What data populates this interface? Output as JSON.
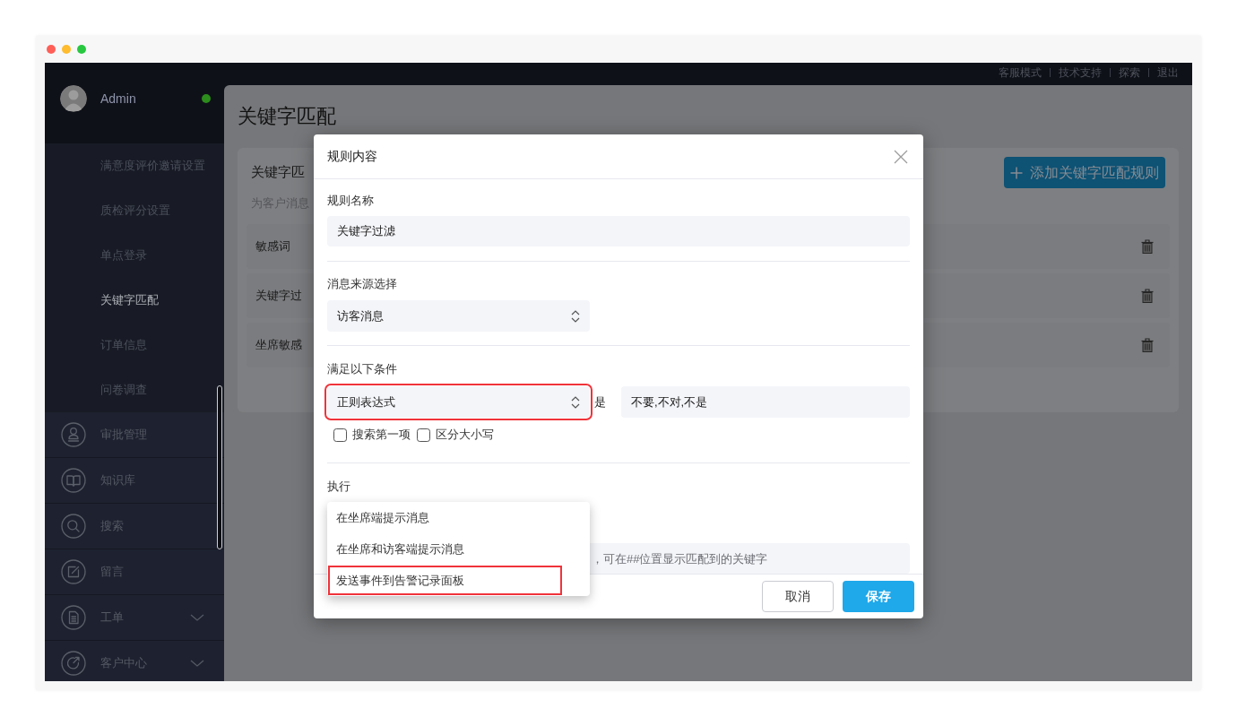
{
  "window": {
    "controls": [
      {
        "color": "#ff5f57"
      },
      {
        "color": "#febc2e"
      },
      {
        "color": "#28c840"
      }
    ]
  },
  "top_bar": {
    "links": [
      "客服模式",
      "技术支持",
      "探索",
      "退出"
    ]
  },
  "sidebar": {
    "user": {
      "name": "Admin",
      "online": true
    },
    "submenu": [
      {
        "label": "满意度评价邀请设置",
        "selected": false
      },
      {
        "label": "质检评分设置",
        "selected": false
      },
      {
        "label": "单点登录",
        "selected": false
      },
      {
        "label": "关键字匹配",
        "selected": true
      },
      {
        "label": "订单信息",
        "selected": false
      },
      {
        "label": "问卷调查",
        "selected": false
      }
    ],
    "menu": [
      {
        "label": "审批管理",
        "expandable": false
      },
      {
        "label": "知识库",
        "expandable": false
      },
      {
        "label": "搜索",
        "expandable": false
      },
      {
        "label": "留言",
        "expandable": false
      },
      {
        "label": "工单",
        "expandable": true
      },
      {
        "label": "客户中心",
        "expandable": true
      }
    ]
  },
  "page": {
    "title": "关键字匹配",
    "card": {
      "title": "关键字匹",
      "subtitle": "为客户消息",
      "add_button": "添加关键字匹配规则",
      "rules": [
        {
          "name": "敏感词"
        },
        {
          "name": "关键字过"
        },
        {
          "name": "坐席敏感"
        }
      ]
    }
  },
  "dialog": {
    "title": "规则内容",
    "rule_name": {
      "label": "规则名称",
      "value": "关键字过滤"
    },
    "source": {
      "label": "消息来源选择",
      "value": "访客消息"
    },
    "conditions": {
      "label": "满足以下条件",
      "match_type": {
        "value": "正则表达式",
        "highlighted": true
      },
      "operator": "是",
      "keywords": {
        "value": "不要,不对,不是"
      },
      "options": [
        {
          "label": "搜索第一项",
          "checked": false
        },
        {
          "label": "区分大小写",
          "checked": false
        }
      ]
    },
    "action": {
      "label": "执行",
      "menu": [
        {
          "label": "在坐席端提示消息",
          "highlighted": false
        },
        {
          "label": "在坐席和访客端提示消息",
          "highlighted": false
        },
        {
          "label": "发送事件到告警记录面板",
          "highlighted": true
        }
      ],
      "message": {
        "placeholder": "，可在##位置显示匹配到的关键字"
      }
    },
    "buttons": [
      {
        "label": "取消",
        "kind": "secondary"
      },
      {
        "label": "保存",
        "kind": "primary"
      }
    ]
  }
}
